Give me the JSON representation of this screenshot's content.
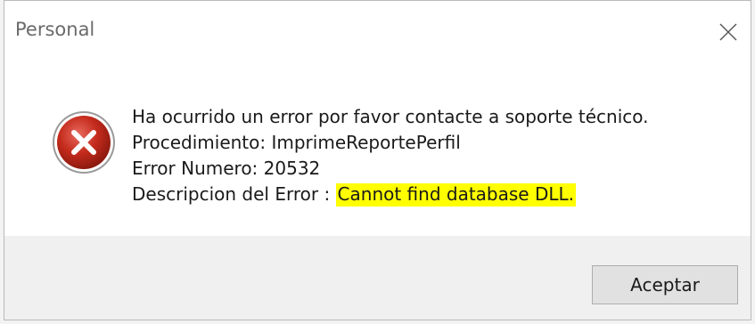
{
  "window": {
    "title": "Personal",
    "close_icon": "close-icon"
  },
  "message": {
    "icon": "error-icon",
    "line1": "Ha ocurrido un error por favor contacte a soporte técnico.",
    "line2": "Procedimiento: ImprimeReportePerfil",
    "line3": "Error Numero: 20532",
    "line4_prefix": "Descripcion del Error : ",
    "line4_highlight": "Cannot find database DLL."
  },
  "footer": {
    "ok_label": "Aceptar"
  },
  "colors": {
    "error_red": "#c42b1c",
    "highlight": "#ffff00",
    "footer_bg": "#f0f0f0"
  }
}
